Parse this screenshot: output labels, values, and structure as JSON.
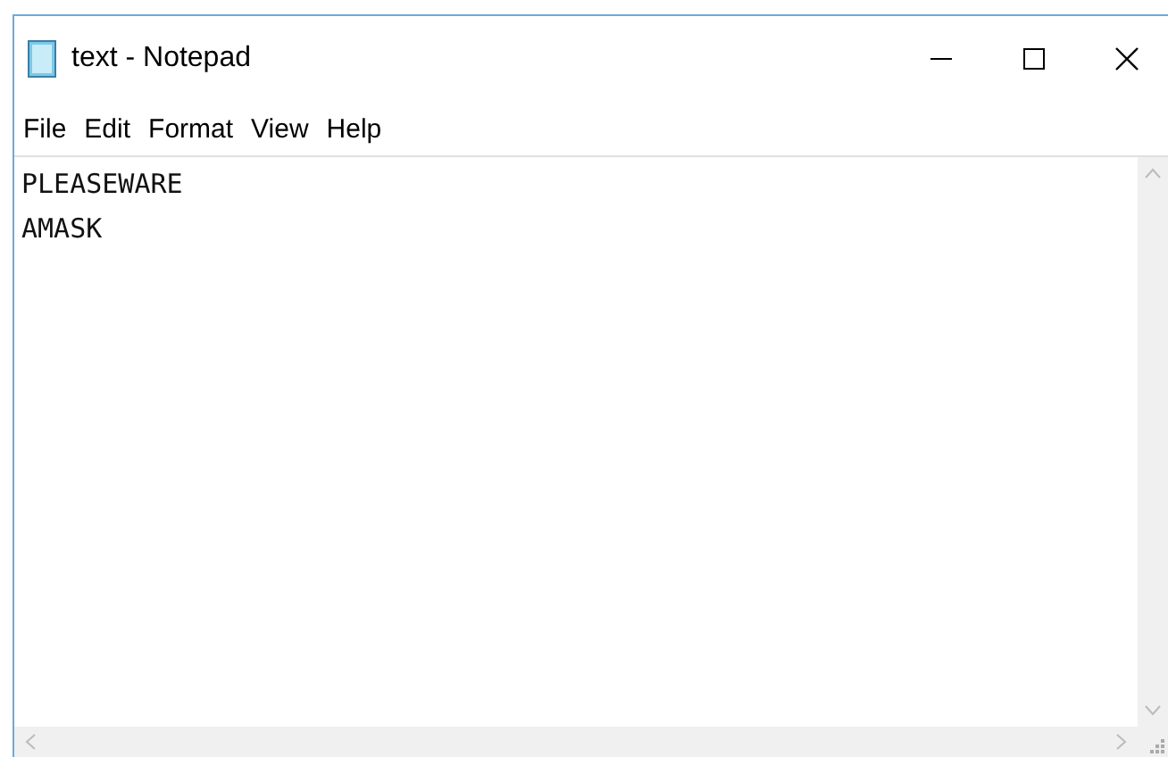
{
  "window": {
    "title": "text - Notepad"
  },
  "menu": [
    {
      "label": "File"
    },
    {
      "label": "Edit"
    },
    {
      "label": "Format"
    },
    {
      "label": "View"
    },
    {
      "label": "Help"
    }
  ],
  "editor": {
    "lines": [
      "PLEASEWARE",
      "AMASK"
    ]
  }
}
